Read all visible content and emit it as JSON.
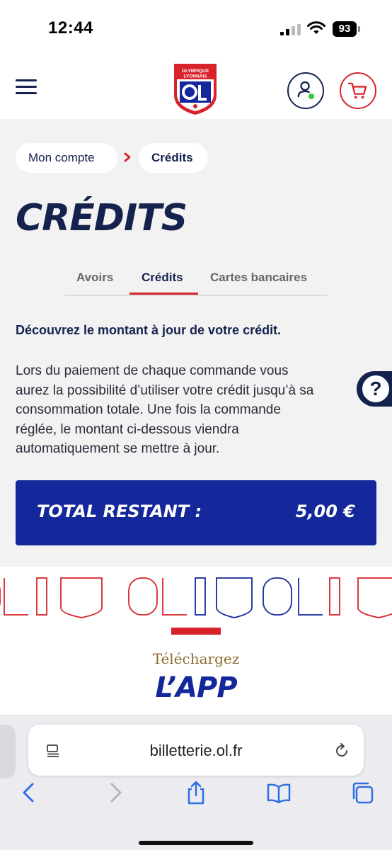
{
  "status_bar": {
    "time": "12:44",
    "battery": "93"
  },
  "header": {
    "logo_text": [
      "OLYMPIQUE",
      "LYONNAIS"
    ],
    "brand_colors": {
      "navy": "#14224d",
      "red": "#d8232a",
      "blue": "#14289b"
    }
  },
  "breadcrumb": {
    "items": [
      "Mon compte",
      "Crédits"
    ]
  },
  "page": {
    "title": "CRÉDITS",
    "tabs": [
      "Avoirs",
      "Crédits",
      "Cartes bancaires"
    ],
    "active_tab": "Crédits",
    "intro": "Découvrez le montant à jour de votre crédit.",
    "paragraph_lines": [
      "Lors du paiement de chaque commande vous",
      "aurez la possibilité d’utiliser votre crédit jusqu’à sa",
      "consommation totale. Une fois la commande",
      "réglée, le montant ci-dessous viendra",
      "automatiquement se mettre à jour."
    ],
    "help_label": "?"
  },
  "total": {
    "label": "TOTAL RESTANT :",
    "value": "5,00 €"
  },
  "app_promo": {
    "pretitle": "Téléchargez",
    "title": "L’APP"
  },
  "browser": {
    "url": "billetterie.ol.fr"
  }
}
